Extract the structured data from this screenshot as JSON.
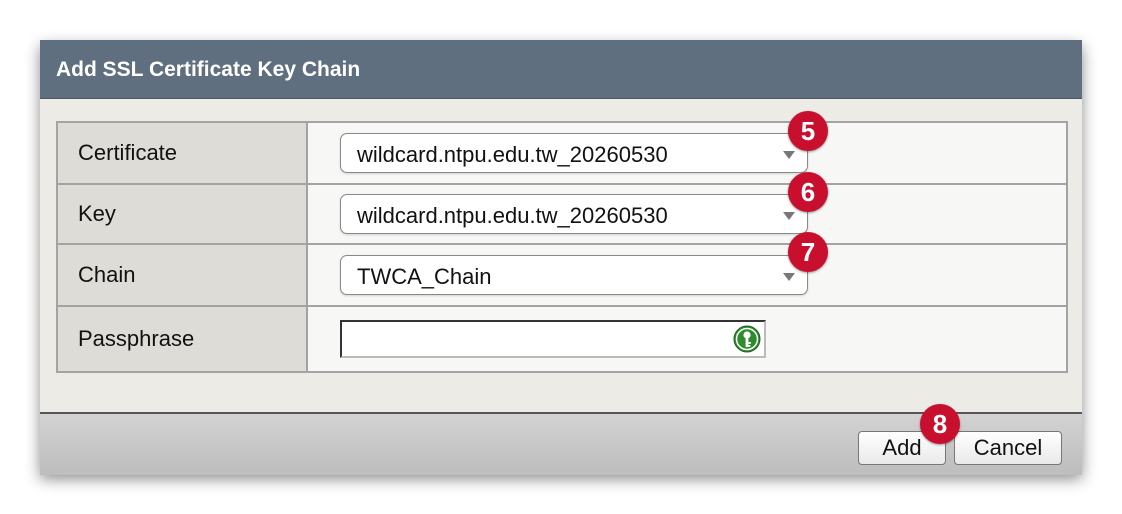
{
  "dialog": {
    "title": "Add SSL Certificate Key Chain"
  },
  "form": {
    "certificate": {
      "label": "Certificate",
      "value": "wildcard.ntpu.edu.tw_20260530",
      "badge": "5"
    },
    "key": {
      "label": "Key",
      "value": "wildcard.ntpu.edu.tw_20260530",
      "badge": "6"
    },
    "chain": {
      "label": "Chain",
      "value": "TWCA_Chain",
      "badge": "7"
    },
    "passphrase": {
      "label": "Passphrase",
      "value": "",
      "icon": "key-icon"
    }
  },
  "footer": {
    "add_label": "Add",
    "add_badge": "8",
    "cancel_label": "Cancel"
  },
  "colors": {
    "titlebar": "#5f6f80",
    "badge": "#c8102e",
    "key_icon": "#2e8b2e"
  }
}
